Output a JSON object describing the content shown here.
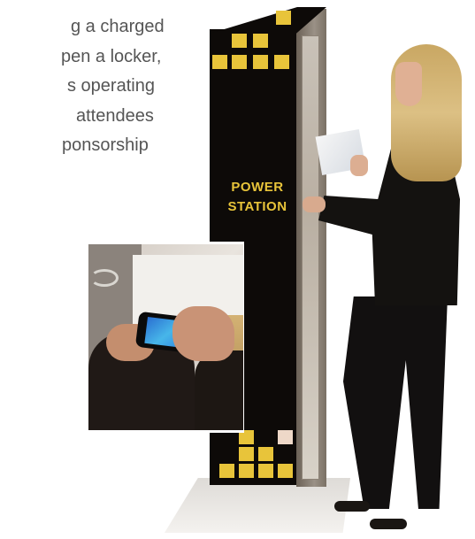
{
  "text_lines": [
    "g a charged",
    "pen a locker,",
    "s operating",
    "attendees",
    "ponsorship"
  ],
  "kiosk": {
    "label_line1": "POWER",
    "label_line2": "STATION"
  },
  "colors": {
    "text": "#555555",
    "kiosk_body": "#0d0a08",
    "kiosk_accent": "#e8c43a"
  }
}
